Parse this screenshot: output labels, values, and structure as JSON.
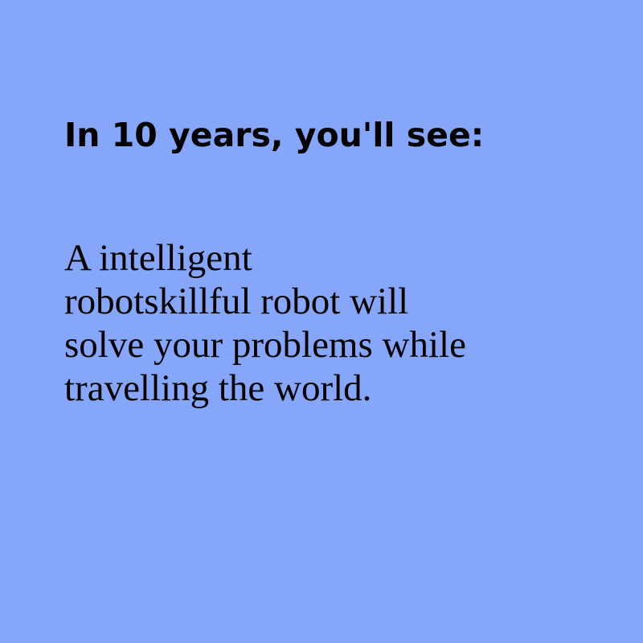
{
  "colors": {
    "background": "#85a6f9",
    "text": "#000000"
  },
  "card": {
    "heading": "In 10 years, you'll see:",
    "body_lines": [
      "A intelligent",
      "robotskillful robot will",
      "solve your problems while",
      "travelling the world."
    ]
  }
}
